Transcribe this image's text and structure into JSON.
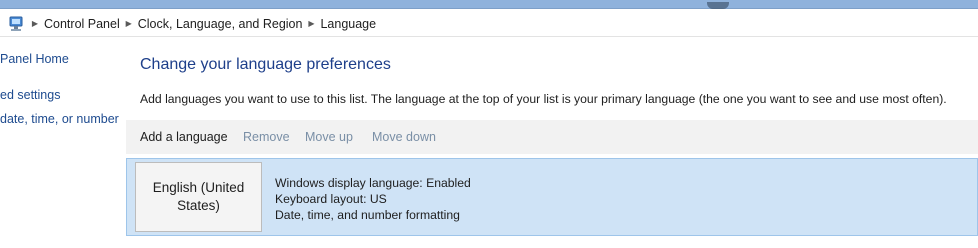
{
  "breadcrumb": {
    "icon": "control-panel-icon",
    "items": [
      "Control Panel",
      "Clock, Language, and Region",
      "Language"
    ]
  },
  "sidebar": {
    "items": [
      {
        "label": "Panel Home"
      },
      {
        "label": "ed settings"
      },
      {
        "label": "date, time, or number"
      }
    ]
  },
  "main": {
    "title": "Change your language preferences",
    "description": "Add languages you want to use to this list. The language at the top of your list is your primary language (the one you want to see and use most often).",
    "toolbar": {
      "add_label": "Add a language",
      "remove_label": "Remove",
      "move_up_label": "Move up",
      "move_down_label": "Move down"
    },
    "languages": [
      {
        "name": "English (United States)",
        "details": [
          "Windows display language: Enabled",
          "Keyboard layout: US",
          "Date, time, and number formatting"
        ]
      }
    ]
  },
  "colors": {
    "title_blue": "#1e3f8a",
    "link_blue": "#1e4b8f",
    "selected_row": "#cfe3f6",
    "titlebar": "#8fb2dc"
  }
}
